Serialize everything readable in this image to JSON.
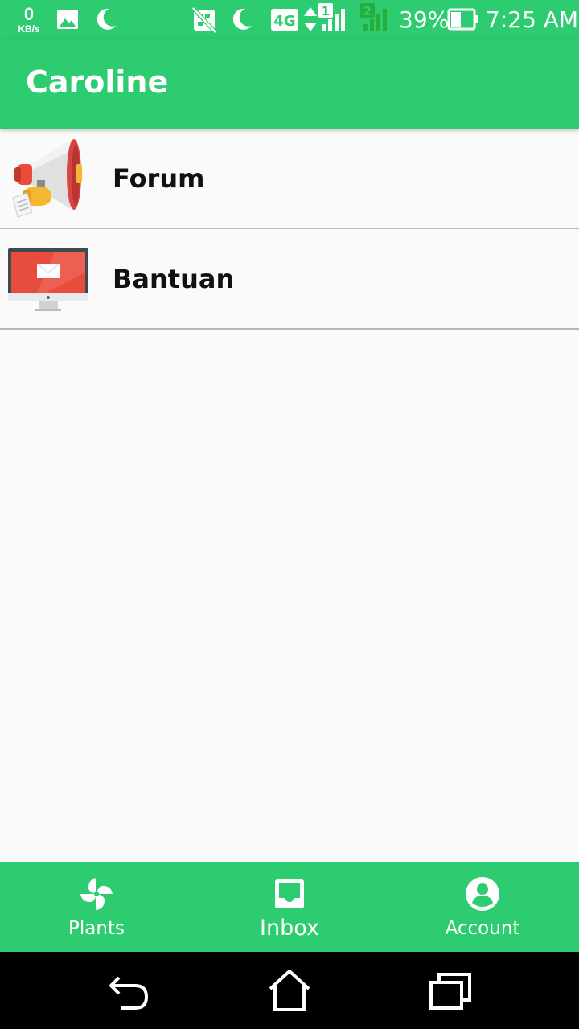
{
  "status_bar": {
    "net_speed_value": "0",
    "net_speed_unit": "KB/s",
    "battery": "39%",
    "time": "7:25 AM",
    "icons": [
      "image-icon",
      "moon-icon",
      "no-sim-icon",
      "moon-icon",
      "4g-icon",
      "data-arrows-icon",
      "signal-sim1-icon",
      "signal-sim2-icon",
      "battery-icon"
    ]
  },
  "app_bar": {
    "title": "Caroline"
  },
  "menu": {
    "items": [
      {
        "label": "Forum",
        "icon": "megaphone-icon"
      },
      {
        "label": "Bantuan",
        "icon": "monitor-icon"
      }
    ]
  },
  "bottom_nav": {
    "items": [
      {
        "label": "Plants",
        "icon": "pinwheel-icon"
      },
      {
        "label": "Inbox",
        "icon": "inbox-icon",
        "active": true
      },
      {
        "label": "Account",
        "icon": "account-circle-icon"
      }
    ]
  },
  "system_nav": {
    "buttons": [
      "back-icon",
      "home-icon",
      "recents-icon"
    ]
  },
  "colors": {
    "primary": "#2ecc71",
    "background": "#fafafa",
    "divider": "#b7b7b7",
    "text": "#111111"
  }
}
